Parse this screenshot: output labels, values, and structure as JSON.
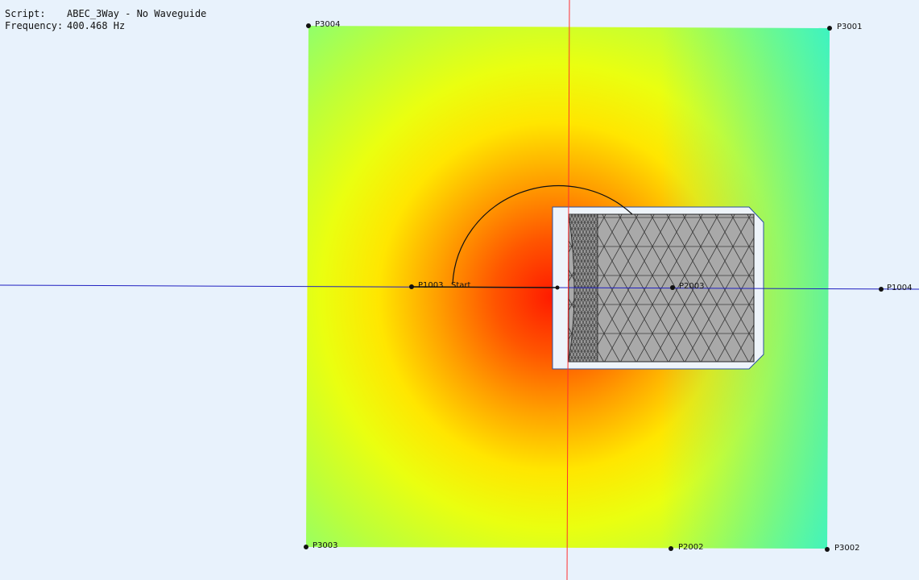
{
  "info": {
    "script_label": "Script:",
    "script_value": "ABEC_3Way - No Waveguide",
    "frequency_label": "Frequency:",
    "frequency_value": "400.468 Hz"
  },
  "points": {
    "p3004": "P3004",
    "p3001": "P3001",
    "p1004": "P1004",
    "p2003": "P2003",
    "p1003": "P1003",
    "start": "Start",
    "p2002": "P2002",
    "p3002": "P3002",
    "p3003": "P3003"
  },
  "colors": {
    "background": "#e8f2fc",
    "hot": "#ff1a00",
    "warm": "#ffff00",
    "cool": "#00f0ff",
    "axis_vertical": "#ff3030",
    "axis_horizontal": "#2020c0",
    "mesh_fill": "#a9a9a9",
    "enclosure": "#eef4fa"
  }
}
